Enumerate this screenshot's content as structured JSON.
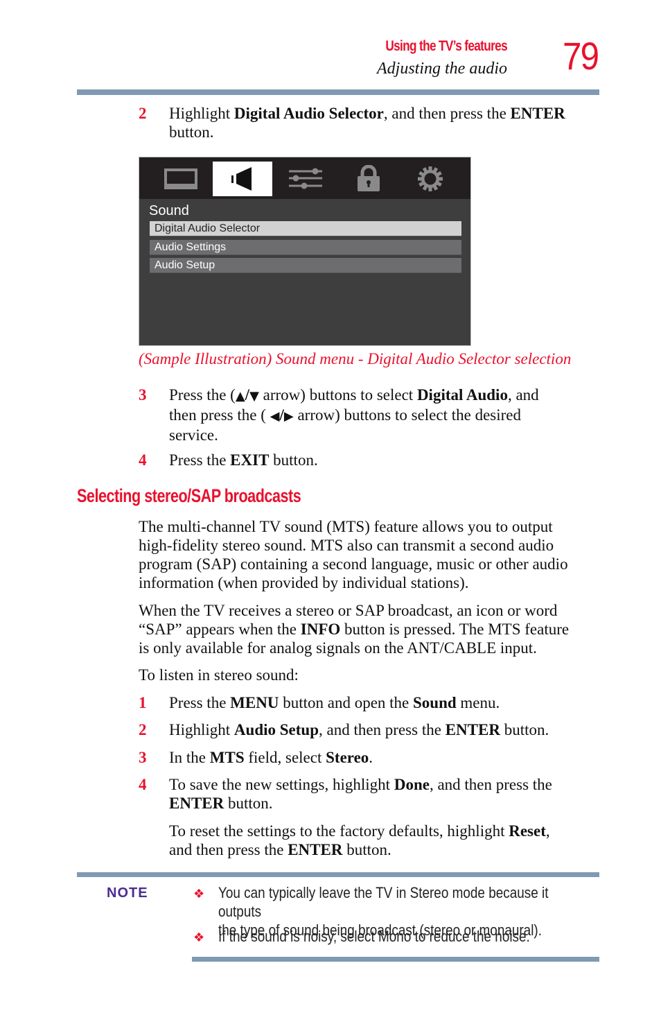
{
  "header": {
    "chapter": "Using the TV’s features",
    "section": "Adjusting the audio",
    "page_number": "79"
  },
  "steps_a": [
    {
      "num": "2",
      "parts": [
        {
          "t": "Highlight "
        },
        {
          "b": "Digital Audio Selector"
        },
        {
          "t": ", and then press the "
        },
        {
          "b": "ENTER"
        }
      ],
      "line2": "button."
    }
  ],
  "tv_menu": {
    "tabs": [
      {
        "icon": "picture-icon",
        "active": false
      },
      {
        "icon": "speaker-icon",
        "active": true
      },
      {
        "icon": "sliders-icon",
        "active": false
      },
      {
        "icon": "lock-icon",
        "active": false
      },
      {
        "icon": "gear-icon",
        "active": false
      }
    ],
    "title": "Sound",
    "items": [
      "Digital Audio Selector",
      "Audio Settings",
      "Audio Setup"
    ],
    "selected_index": 0
  },
  "caption": "(Sample Illustration) Sound menu - Digital Audio Selector selection",
  "steps_b": {
    "step3": {
      "num": "3",
      "l1_a": "Press the (",
      "arrow_up": "▲",
      "slash": "/",
      "arrow_down": "▼",
      "l1_b": " arrow) buttons to select ",
      "l1_bold": "Digital Audio",
      "l1_c": ", and",
      "l2_a": "then press the ( ",
      "arrow_left": "◀",
      "arrow_right": "▶",
      "l2_b": " arrow) buttons to select the desired",
      "l3": "service."
    },
    "step4": {
      "num": "4",
      "a": "Press the ",
      "bold": "EXIT",
      "b": " button."
    }
  },
  "section_heading": "Selecting stereo/SAP broadcasts",
  "paragraphs": {
    "p1": [
      "The multi-channel TV sound (MTS) feature allows you to output",
      "high-fidelity stereo sound. MTS also can transmit a second audio",
      "program (SAP) containing a second language, music or other audio",
      "information (when provided by individual stations)."
    ],
    "p2_l1": "When the TV receives a stereo or SAP broadcast, an icon or word",
    "p2_l2_a": "“SAP” appears when the ",
    "p2_l2_bold": "INFO",
    "p2_l2_b": " button is pressed. The MTS feature",
    "p2_l3": "is only available for analog signals on the ANT/CABLE input.",
    "p3": "To listen in stereo sound:"
  },
  "steps_c": {
    "s1": {
      "num": "1",
      "a": "Press the ",
      "b1": "MENU",
      "c": " button and open the ",
      "b2": "Sound",
      "d": " menu."
    },
    "s2": {
      "num": "2",
      "a": "Highlight ",
      "b1": "Audio Setup",
      "c": ", and then press the ",
      "b2": "ENTER",
      "d": " button."
    },
    "s3": {
      "num": "3",
      "a": "In the ",
      "b1": "MTS",
      "c": " field, select ",
      "b2": "Stereo",
      "d": "."
    },
    "s4": {
      "num": "4",
      "a": "To save the new settings, highlight ",
      "b1": "Done",
      "c": ", and then press the",
      "b2": "ENTER",
      "d": " button."
    },
    "s4_extra": {
      "a": "To reset the settings to the factory defaults, highlight ",
      "b1": "Reset",
      "c": ",",
      "d": "and then press the ",
      "b2": "ENTER",
      "e": " button."
    }
  },
  "note": {
    "label": "NOTE",
    "bullet": "❖",
    "items": [
      {
        "l1": "You can typically leave the TV in Stereo mode because it outputs",
        "l2": "the type of sound being broadcast (stereo or monaural)."
      },
      {
        "l1": "If the sound is noisy, select Mono to reduce the noise."
      }
    ]
  },
  "colors": {
    "accent_red": "#e8112d",
    "rule_blue": "#7f9ab2",
    "note_purple": "#4b2c8f",
    "menu_dark": "#3e3e3e",
    "menu_bar": "#231f20"
  }
}
